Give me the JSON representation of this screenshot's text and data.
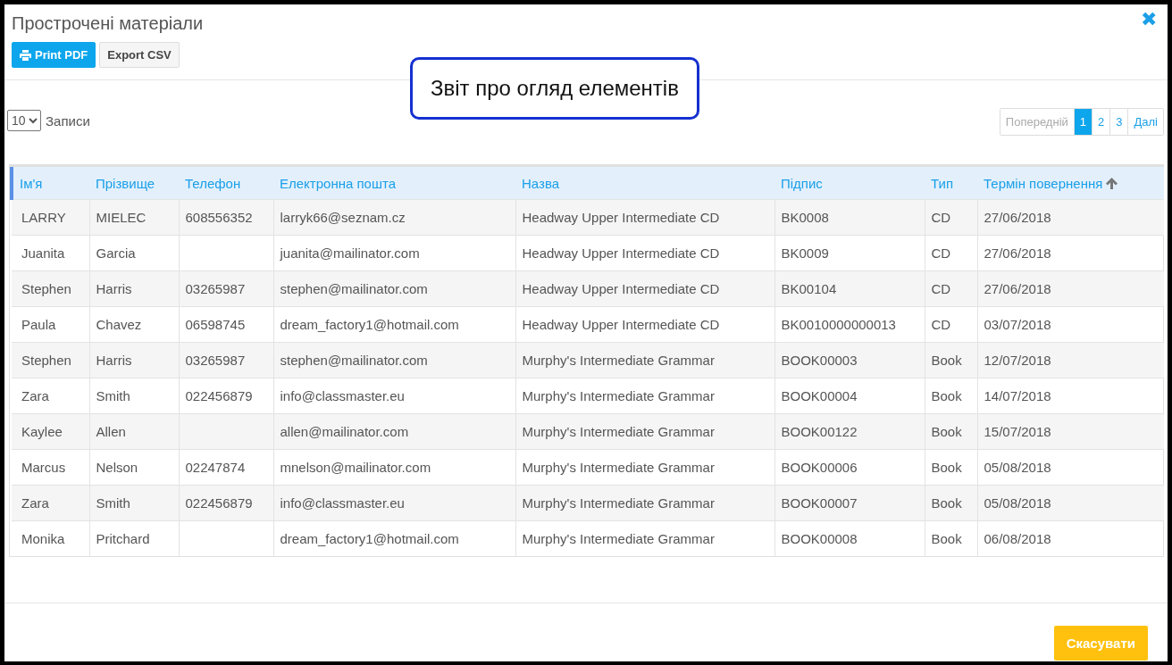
{
  "dialog": {
    "title": "Прострочені матеріали",
    "close_label": "✖"
  },
  "toolbar": {
    "buttons": [
      {
        "label": "Print PDF",
        "kind": "primary"
      },
      {
        "label": "Export CSV",
        "kind": "default"
      }
    ]
  },
  "callout": {
    "text": "Звіт про огляд елементів"
  },
  "length_select": {
    "value": "10",
    "label": "Записи"
  },
  "pagination": {
    "previous": {
      "label": "Попередній",
      "disabled": true
    },
    "pages": [
      {
        "label": "1",
        "selected": true
      },
      {
        "label": "2",
        "selected": false
      },
      {
        "label": "3",
        "selected": false
      }
    ],
    "next": {
      "label": "Далі",
      "disabled": false
    }
  },
  "table": {
    "columns": [
      {
        "label": "Ім'я",
        "sorted": false
      },
      {
        "label": "Прізвище",
        "sorted": false
      },
      {
        "label": "Телефон",
        "sorted": false
      },
      {
        "label": "Електронна пошта",
        "sorted": false
      },
      {
        "label": "Назва",
        "sorted": false
      },
      {
        "label": "Підпис",
        "sorted": false
      },
      {
        "label": "Тип",
        "sorted": false
      },
      {
        "label": "Термін повернення",
        "sorted": true
      }
    ],
    "rows": [
      [
        "LARRY",
        "MIELEC",
        "608556352",
        "larryk66@seznam.cz",
        "Headway Upper Intermediate CD",
        "BK0008",
        "CD",
        "27/06/2018"
      ],
      [
        "Juanita",
        "Garcia",
        "",
        "juanita@mailinator.com",
        "Headway Upper Intermediate CD",
        "BK0009",
        "CD",
        "27/06/2018"
      ],
      [
        "Stephen",
        "Harris",
        "03265987",
        "stephen@mailinator.com",
        "Headway Upper Intermediate CD",
        "BK00104",
        "CD",
        "27/06/2018"
      ],
      [
        "Paula",
        "Chavez",
        "06598745",
        "dream_factory1@hotmail.com",
        "Headway Upper Intermediate CD",
        "BK0010000000013",
        "CD",
        "03/07/2018"
      ],
      [
        "Stephen",
        "Harris",
        "03265987",
        "stephen@mailinator.com",
        "Murphy's Intermediate Grammar",
        "BOOK00003",
        "Book",
        "12/07/2018"
      ],
      [
        "Zara",
        "Smith",
        "022456879",
        "info@classmaster.eu",
        "Murphy's Intermediate Grammar",
        "BOOK00004",
        "Book",
        "14/07/2018"
      ],
      [
        "Kaylee",
        "Allen",
        "",
        "allen@mailinator.com",
        "Murphy's Intermediate Grammar",
        "BOOK00122",
        "Book",
        "15/07/2018"
      ],
      [
        "Marcus",
        "Nelson",
        "02247874",
        "mnelson@mailinator.com",
        "Murphy's Intermediate Grammar",
        "BOOK00006",
        "Book",
        "05/08/2018"
      ],
      [
        "Zara",
        "Smith",
        "022456879",
        "info@classmaster.eu",
        "Murphy's Intermediate Grammar",
        "BOOK00007",
        "Book",
        "05/08/2018"
      ],
      [
        "Monika",
        "Pritchard",
        "",
        "dream_factory1@hotmail.com",
        "Murphy's Intermediate Grammar",
        "BOOK00008",
        "Book",
        "06/08/2018"
      ]
    ]
  },
  "footer": {
    "cancel_label": "Скасувати"
  }
}
